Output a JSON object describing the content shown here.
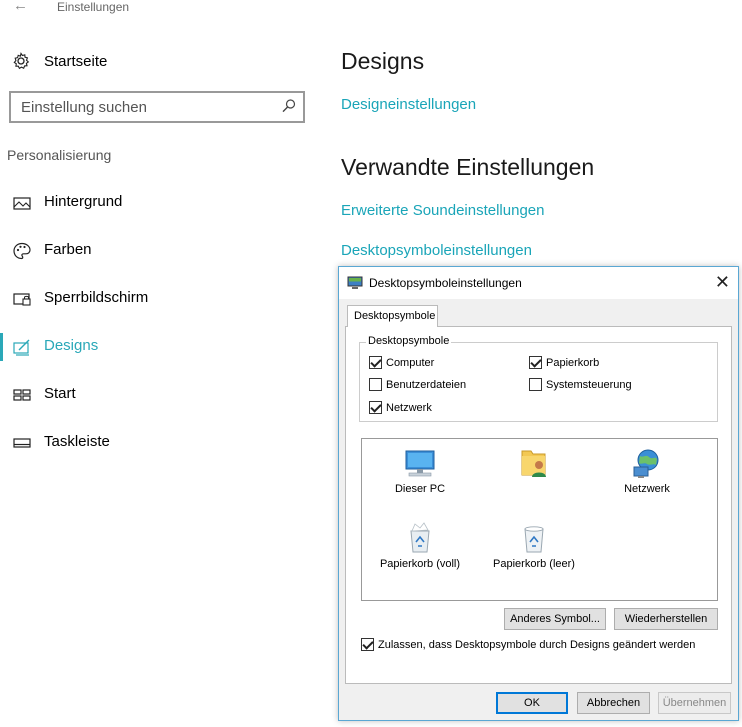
{
  "window": {
    "title": "Einstellungen",
    "back_icon": "back-arrow-icon"
  },
  "sidebar": {
    "home_label": "Startseite",
    "search_placeholder": "Einstellung suchen",
    "section": "Personalisierung",
    "items": [
      {
        "label": "Hintergrund",
        "icon": "picture-icon",
        "active": false
      },
      {
        "label": "Farben",
        "icon": "palette-icon",
        "active": false
      },
      {
        "label": "Sperrbildschirm",
        "icon": "lockscreen-icon",
        "active": false
      },
      {
        "label": "Designs",
        "icon": "designs-icon",
        "active": true
      },
      {
        "label": "Start",
        "icon": "start-icon",
        "active": false
      },
      {
        "label": "Taskleiste",
        "icon": "taskbar-icon",
        "active": false
      }
    ]
  },
  "main": {
    "heading": "Designs",
    "design_settings_link": "Designeinstellungen",
    "related_heading": "Verwandte Einstellungen",
    "links": [
      "Erweiterte Soundeinstellungen",
      "Desktopsymboleinstellungen"
    ],
    "accent_color": "#1aa5b8"
  },
  "dialog": {
    "title": "Desktopsymboleinstellungen",
    "tab": "Desktopsymbole",
    "group_title": "Desktopsymbole",
    "checkboxes": [
      {
        "label": "Computer",
        "checked": true
      },
      {
        "label": "Papierkorb",
        "checked": true
      },
      {
        "label": "Benutzerdateien",
        "checked": false
      },
      {
        "label": "Systemsteuerung",
        "checked": false
      },
      {
        "label": "Netzwerk",
        "checked": true
      }
    ],
    "icons": [
      {
        "label": "Dieser PC",
        "icon": "computer-icon"
      },
      {
        "label": "",
        "icon": "user-folder-icon"
      },
      {
        "label": "Netzwerk",
        "icon": "network-icon"
      },
      {
        "label": "Papierkorb (voll)",
        "icon": "recycle-bin-full-icon"
      },
      {
        "label": "Papierkorb (leer)",
        "icon": "recycle-bin-empty-icon"
      }
    ],
    "change_icon_button": "Anderes Symbol...",
    "restore_button": "Wiederherstellen",
    "allow_themes_checkbox": {
      "label": "Zulassen, dass Desktopsymbole durch Designs geändert werden",
      "checked": true
    },
    "ok_button": "OK",
    "cancel_button": "Abbrechen",
    "apply_button": "Übernehmen"
  }
}
